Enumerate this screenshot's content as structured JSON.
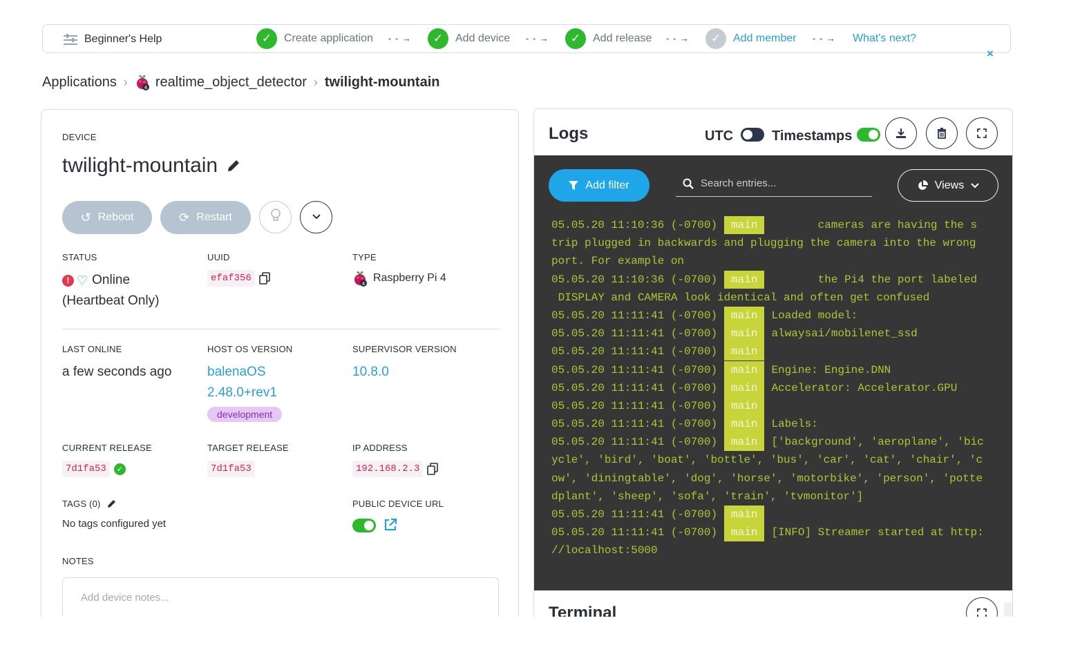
{
  "help": {
    "title": "Beginner's Help",
    "steps": [
      "Create application",
      "Add device",
      "Add release",
      "Add member",
      "What's next?"
    ],
    "arrow": "- - →",
    "close": "×"
  },
  "breadcrumb": {
    "applications": "Applications",
    "app": "realtime_object_detector",
    "device": "twilight-mountain"
  },
  "device": {
    "section_label": "DEVICE",
    "name": "twilight-mountain",
    "reboot": "Reboot",
    "restart": "Restart",
    "status_label": "STATUS",
    "status_value": "Online",
    "status_sub": "(Heartbeat Only)",
    "uuid_label": "UUID",
    "uuid": "efaf356",
    "type_label": "TYPE",
    "type": "Raspberry Pi 4",
    "last_online_label": "LAST ONLINE",
    "last_online": "a few seconds ago",
    "host_os_label": "HOST OS VERSION",
    "host_os_name": "balenaOS",
    "host_os_version": "2.48.0+rev1",
    "host_os_badge": "development",
    "supervisor_label": "SUPERVISOR VERSION",
    "supervisor": "10.8.0",
    "current_release_label": "CURRENT RELEASE",
    "current_release": "7d1fa53",
    "target_release_label": "TARGET RELEASE",
    "target_release": "7d1fa53",
    "ip_label": "IP ADDRESS",
    "ip": "192.168.2.3",
    "tags_label": "TAGS (0)",
    "tags_empty": "No tags configured yet",
    "public_url_label": "PUBLIC DEVICE URL",
    "public_url_enabled": true,
    "notes_label": "NOTES",
    "notes_placeholder": "Add device notes..."
  },
  "logs": {
    "title": "Logs",
    "utc_label": "UTC",
    "utc_on": false,
    "timestamps_label": "Timestamps",
    "timestamps_on": true,
    "add_filter": "Add filter",
    "search_placeholder": "Search entries...",
    "views": "Views",
    "lines": [
      {
        "ts": "05.05.20 11:10:36 (-0700)",
        "tag": "main",
        "msg": "       cameras are having the s"
      },
      {
        "ts": "",
        "tag": "",
        "msg": "trip plugged in backwards and plugging the camera into the wrong"
      },
      {
        "ts": "",
        "tag": "",
        "msg": "port. For example on"
      },
      {
        "ts": "05.05.20 11:10:36 (-0700)",
        "tag": "main",
        "msg": "       the Pi4 the port labeled"
      },
      {
        "ts": "",
        "tag": "",
        "msg": " DISPLAY and CAMERA look identical and often get confused"
      },
      {
        "ts": "05.05.20 11:11:41 (-0700)",
        "tag": "main",
        "msg": "Loaded model:"
      },
      {
        "ts": "05.05.20 11:11:41 (-0700)",
        "tag": "main",
        "msg": "alwaysai/mobilenet_ssd"
      },
      {
        "ts": "05.05.20 11:11:41 (-0700)",
        "tag": "main",
        "msg": ""
      },
      {
        "ts": "05.05.20 11:11:41 (-0700)",
        "tag": "main",
        "msg": "Engine: Engine.DNN"
      },
      {
        "ts": "05.05.20 11:11:41 (-0700)",
        "tag": "main",
        "msg": "Accelerator: Accelerator.GPU"
      },
      {
        "ts": "05.05.20 11:11:41 (-0700)",
        "tag": "main",
        "msg": ""
      },
      {
        "ts": "05.05.20 11:11:41 (-0700)",
        "tag": "main",
        "msg": "Labels:"
      },
      {
        "ts": "05.05.20 11:11:41 (-0700)",
        "tag": "main",
        "msg": "['background', 'aeroplane', 'bic"
      },
      {
        "ts": "",
        "tag": "",
        "msg": "ycle', 'bird', 'boat', 'bottle', 'bus', 'car', 'cat', 'chair', 'c"
      },
      {
        "ts": "",
        "tag": "",
        "msg": "ow', 'diningtable', 'dog', 'horse', 'motorbike', 'person', 'potte"
      },
      {
        "ts": "",
        "tag": "",
        "msg": "dplant', 'sheep', 'sofa', 'train', 'tvmonitor']"
      },
      {
        "ts": "05.05.20 11:11:41 (-0700)",
        "tag": "main",
        "msg": ""
      },
      {
        "ts": "05.05.20 11:11:41 (-0700)",
        "tag": "main",
        "msg": "[INFO] Streamer started at http:"
      },
      {
        "ts": "",
        "tag": "",
        "msg": "//localhost:5000"
      }
    ]
  },
  "terminal": {
    "title": "Terminal"
  },
  "colors": {
    "accent": "#2a9fd8",
    "success": "#2eb82e",
    "log_text": "#a9c833",
    "log_tag_bg": "#c7d43a",
    "logs_bg": "#363636",
    "filter_blue": "#1ea6e8"
  },
  "icons": {
    "help": "sliders-icon",
    "check": "check-circle-icon",
    "edit": "pencil-icon",
    "copy": "copy-icon",
    "reboot": "rotate-ccw-icon",
    "restart": "refresh-icon",
    "lightbulb": "lightbulb-icon",
    "chevron": "chevron-down-icon",
    "download": "download-icon",
    "trash": "trash-icon",
    "fullscreen": "expand-icon",
    "filter": "filter-icon",
    "search": "search-icon",
    "views": "pie-chart-icon",
    "external": "external-link-icon",
    "raspberry": "raspberry-pi-icon"
  }
}
